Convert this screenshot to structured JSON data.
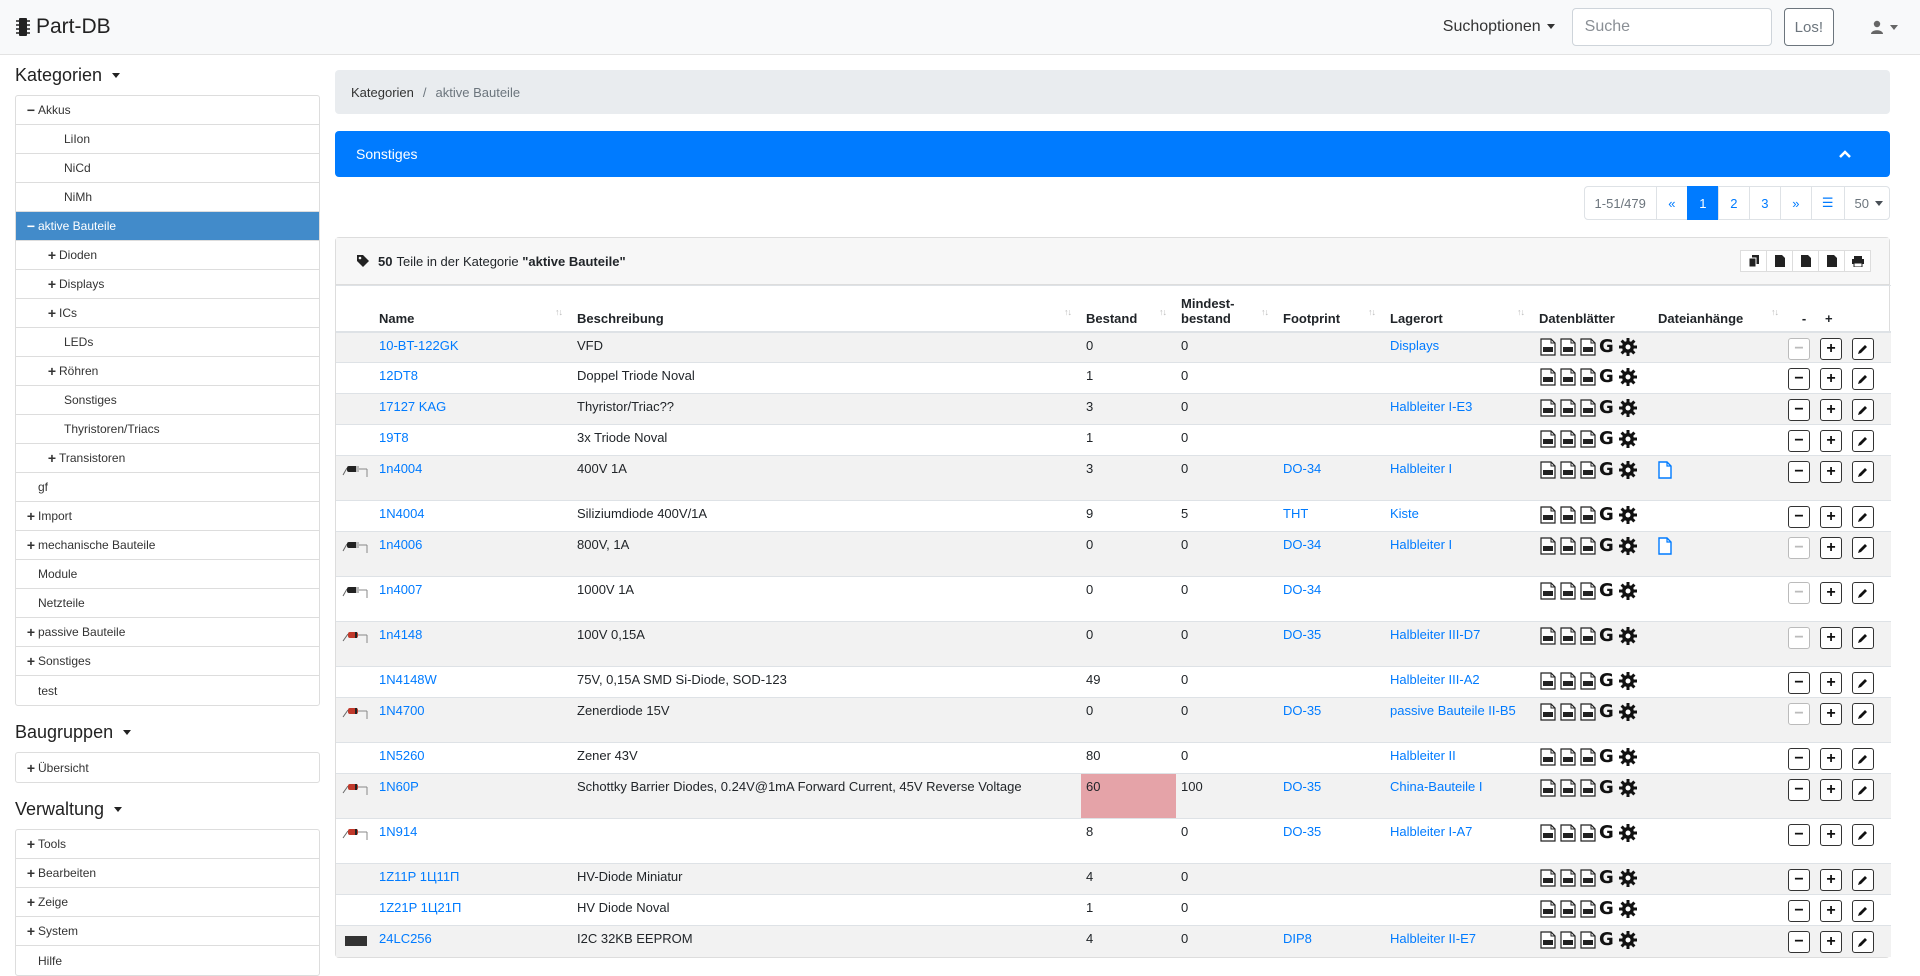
{
  "navbar": {
    "brand": "Part-DB",
    "search_options": "Suchoptionen",
    "search_placeholder": "Suche",
    "search_button": "Los!"
  },
  "sidebar": {
    "kategorien_title": "Kategorien",
    "baugruppen_title": "Baugruppen",
    "verwaltung_title": "Verwaltung",
    "categories": [
      {
        "label": "Akkus",
        "toggle": "−",
        "level": 0
      },
      {
        "label": "LiIon",
        "toggle": "",
        "level": 1
      },
      {
        "label": "NiCd",
        "toggle": "",
        "level": 1
      },
      {
        "label": "NiMh",
        "toggle": "",
        "level": 1
      },
      {
        "label": "aktive Bauteile",
        "toggle": "−",
        "level": 0,
        "active": true
      },
      {
        "label": "Dioden",
        "toggle": "+",
        "level": 1
      },
      {
        "label": "Displays",
        "toggle": "+",
        "level": 1
      },
      {
        "label": "ICs",
        "toggle": "+",
        "level": 1
      },
      {
        "label": "LEDs",
        "toggle": "",
        "level": 1
      },
      {
        "label": "Röhren",
        "toggle": "+",
        "level": 1
      },
      {
        "label": "Sonstiges",
        "toggle": "",
        "level": 1
      },
      {
        "label": "Thyristoren/Triacs",
        "toggle": "",
        "level": 1
      },
      {
        "label": "Transistoren",
        "toggle": "+",
        "level": 1
      },
      {
        "label": "gf",
        "toggle": "",
        "level": 0
      },
      {
        "label": "Import",
        "toggle": "+",
        "level": 0
      },
      {
        "label": "mechanische Bauteile",
        "toggle": "+",
        "level": 0
      },
      {
        "label": "Module",
        "toggle": "",
        "level": 0
      },
      {
        "label": "Netzteile",
        "toggle": "",
        "level": 0
      },
      {
        "label": "passive Bauteile",
        "toggle": "+",
        "level": 0
      },
      {
        "label": "Sonstiges",
        "toggle": "+",
        "level": 0
      },
      {
        "label": "test",
        "toggle": "",
        "level": 0
      }
    ],
    "baugruppen": [
      {
        "label": "Übersicht",
        "toggle": "+",
        "level": 0
      }
    ],
    "verwaltung": [
      {
        "label": "Tools",
        "toggle": "+",
        "level": 0
      },
      {
        "label": "Bearbeiten",
        "toggle": "+",
        "level": 0
      },
      {
        "label": "Zeige",
        "toggle": "+",
        "level": 0
      },
      {
        "label": "System",
        "toggle": "+",
        "level": 0
      },
      {
        "label": "Hilfe",
        "toggle": "",
        "level": 0
      }
    ]
  },
  "breadcrumb": {
    "root": "Kategorien",
    "sep": "/",
    "current": "aktive Bauteile"
  },
  "filter_bar": {
    "label": "Sonstiges"
  },
  "pagination": {
    "range": "1-51/479",
    "first": "«",
    "pages": [
      "1",
      "2",
      "3"
    ],
    "active_page": "1",
    "last": "»",
    "list_icon": "☰",
    "per_page": "50"
  },
  "card": {
    "count": "50",
    "text": "Teile in der Kategorie",
    "category": "\"aktive Bauteile\""
  },
  "table": {
    "columns": {
      "name": "Name",
      "beschreibung": "Beschreibung",
      "bestand": "Bestand",
      "mindest1": "Mindest-",
      "mindest2": "bestand",
      "footprint": "Footprint",
      "lagerort": "Lagerort",
      "datenblaetter": "Datenblätter",
      "dateianhaenge": "Dateianhänge",
      "minus": "-",
      "plus": "+"
    },
    "rows": [
      {
        "thumb": "",
        "name": "10-BT-122GK",
        "desc": "VFD",
        "stock": "0",
        "min": "0",
        "footprint": "",
        "location": "Displays",
        "attach": false,
        "minus_disabled": true,
        "low": false,
        "tall": false
      },
      {
        "thumb": "",
        "name": "12DT8",
        "desc": "Doppel Triode Noval",
        "stock": "1",
        "min": "0",
        "footprint": "",
        "location": "",
        "attach": false,
        "minus_disabled": false,
        "low": false,
        "tall": false
      },
      {
        "thumb": "",
        "name": "17127 KAG",
        "desc": "Thyristor/Triac??",
        "stock": "3",
        "min": "0",
        "footprint": "",
        "location": "Halbleiter I-E3",
        "attach": false,
        "minus_disabled": false,
        "low": false,
        "tall": false
      },
      {
        "thumb": "",
        "name": "19T8",
        "desc": "3x Triode Noval",
        "stock": "1",
        "min": "0",
        "footprint": "",
        "location": "",
        "attach": false,
        "minus_disabled": false,
        "low": false,
        "tall": false
      },
      {
        "thumb": "black-diode",
        "name": "1n4004",
        "desc": "400V 1A",
        "stock": "3",
        "min": "0",
        "footprint": "DO-34",
        "location": "Halbleiter I",
        "attach": true,
        "minus_disabled": false,
        "low": false,
        "tall": true
      },
      {
        "thumb": "",
        "name": "1N4004",
        "desc": "Siliziumdiode 400V/1A",
        "stock": "9",
        "min": "5",
        "footprint": "THT",
        "location": "Kiste",
        "attach": false,
        "minus_disabled": false,
        "low": false,
        "tall": false
      },
      {
        "thumb": "black-diode",
        "name": "1n4006",
        "desc": "800V, 1A",
        "stock": "0",
        "min": "0",
        "footprint": "DO-34",
        "location": "Halbleiter I",
        "attach": true,
        "minus_disabled": true,
        "low": false,
        "tall": true
      },
      {
        "thumb": "black-diode",
        "name": "1n4007",
        "desc": "1000V 1A",
        "stock": "0",
        "min": "0",
        "footprint": "DO-34",
        "location": "",
        "attach": false,
        "minus_disabled": true,
        "low": false,
        "tall": true
      },
      {
        "thumb": "red-diode",
        "name": "1n4148",
        "desc": "100V 0,15A",
        "stock": "0",
        "min": "0",
        "footprint": "DO-35",
        "location": "Halbleiter III-D7",
        "attach": false,
        "minus_disabled": true,
        "low": false,
        "tall": true
      },
      {
        "thumb": "",
        "name": "1N4148W",
        "desc": "75V, 0,15A SMD Si-Diode, SOD-123",
        "stock": "49",
        "min": "0",
        "footprint": "",
        "location": "Halbleiter III-A2",
        "attach": false,
        "minus_disabled": false,
        "low": false,
        "tall": false
      },
      {
        "thumb": "red-diode",
        "name": "1N4700",
        "desc": "Zenerdiode 15V",
        "stock": "0",
        "min": "0",
        "footprint": "DO-35",
        "location": "passive Bauteile II-B5",
        "attach": false,
        "minus_disabled": true,
        "low": false,
        "tall": true
      },
      {
        "thumb": "",
        "name": "1N5260",
        "desc": "Zener 43V",
        "stock": "80",
        "min": "0",
        "footprint": "",
        "location": "Halbleiter II",
        "attach": false,
        "minus_disabled": false,
        "low": false,
        "tall": false
      },
      {
        "thumb": "red-diode",
        "name": "1N60P",
        "desc": "Schottky Barrier Diodes, 0.24V@1mA Forward Current, 45V Reverse Voltage",
        "stock": "60",
        "min": "100",
        "footprint": "DO-35",
        "location": "China-Bauteile I",
        "attach": false,
        "minus_disabled": false,
        "low": true,
        "tall": true
      },
      {
        "thumb": "red-diode",
        "name": "1N914",
        "desc": "",
        "stock": "8",
        "min": "0",
        "footprint": "DO-35",
        "location": "Halbleiter I-A7",
        "attach": false,
        "minus_disabled": false,
        "low": false,
        "tall": true
      },
      {
        "thumb": "",
        "name": "1Z11P 1Ц11П",
        "desc": "HV-Diode Miniatur",
        "stock": "4",
        "min": "0",
        "footprint": "",
        "location": "",
        "attach": false,
        "minus_disabled": false,
        "low": false,
        "tall": false
      },
      {
        "thumb": "",
        "name": "1Z21P 1Ц21П",
        "desc": "HV Diode Noval",
        "stock": "1",
        "min": "0",
        "footprint": "",
        "location": "",
        "attach": false,
        "minus_disabled": false,
        "low": false,
        "tall": false
      },
      {
        "thumb": "chip",
        "name": "24LC256",
        "desc": "I2C 32KB EEPROM",
        "stock": "4",
        "min": "0",
        "footprint": "DIP8",
        "location": "Halbleiter II-E7",
        "attach": false,
        "minus_disabled": false,
        "low": false,
        "tall": false
      }
    ]
  },
  "colors": {
    "primary": "#007bff",
    "active_tree": "#428bca",
    "low_stock": "#e5a3a8"
  }
}
